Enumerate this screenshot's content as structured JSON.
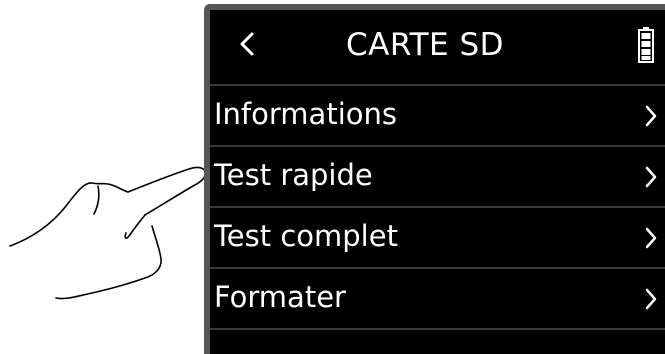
{
  "screen": {
    "title": "CARTE SD",
    "items": [
      {
        "label": "Informations"
      },
      {
        "label": "Test rapide"
      },
      {
        "label": "Test complet"
      },
      {
        "label": "Formater"
      }
    ]
  },
  "icons": {
    "back": "chevron-left-icon",
    "battery": "battery-full-icon",
    "item_arrow": "chevron-right-icon",
    "gesture": "tap-hand-icon"
  },
  "colors": {
    "screen_bg": "#000000",
    "text": "#ffffff",
    "divider": "#3a3a3a",
    "bezel": "#555555"
  }
}
